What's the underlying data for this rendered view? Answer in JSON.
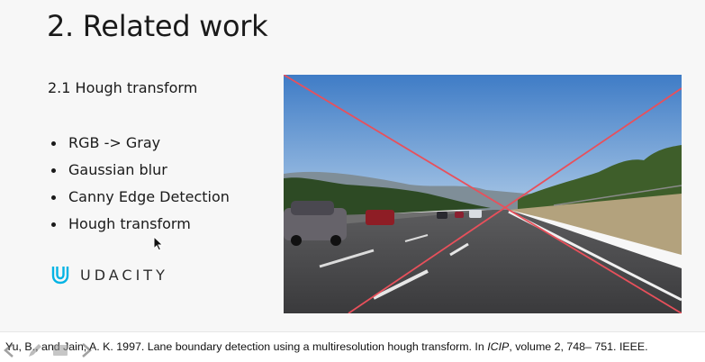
{
  "slide": {
    "title": "2. Related work",
    "subtitle": "2.1 Hough transform",
    "bullets": [
      "RGB -> Gray",
      "Gaussian blur",
      "Canny Edge Detection",
      "Hough transform"
    ],
    "logo": {
      "icon": "udacity-u-icon",
      "text": "UDACITY",
      "color": "#02b3e4"
    },
    "image": {
      "description_icon": "road-lane-photo",
      "line_color": "#e8505b"
    }
  },
  "citation": {
    "authors": "Yu, B., and Jain, A. K. 1997. Lane boundary detection using a multiresolution hough transform. In ",
    "venue": "ICIP",
    "rest": ", volume 2, 748– 751. IEEE."
  },
  "controls": {
    "icons": [
      "prev-slide-icon",
      "pen-icon",
      "menu-icon",
      "next-slide-icon"
    ]
  },
  "colors": {
    "background": "#f7f7f7",
    "text": "#1a1a1a",
    "accent": "#02b3e4"
  }
}
